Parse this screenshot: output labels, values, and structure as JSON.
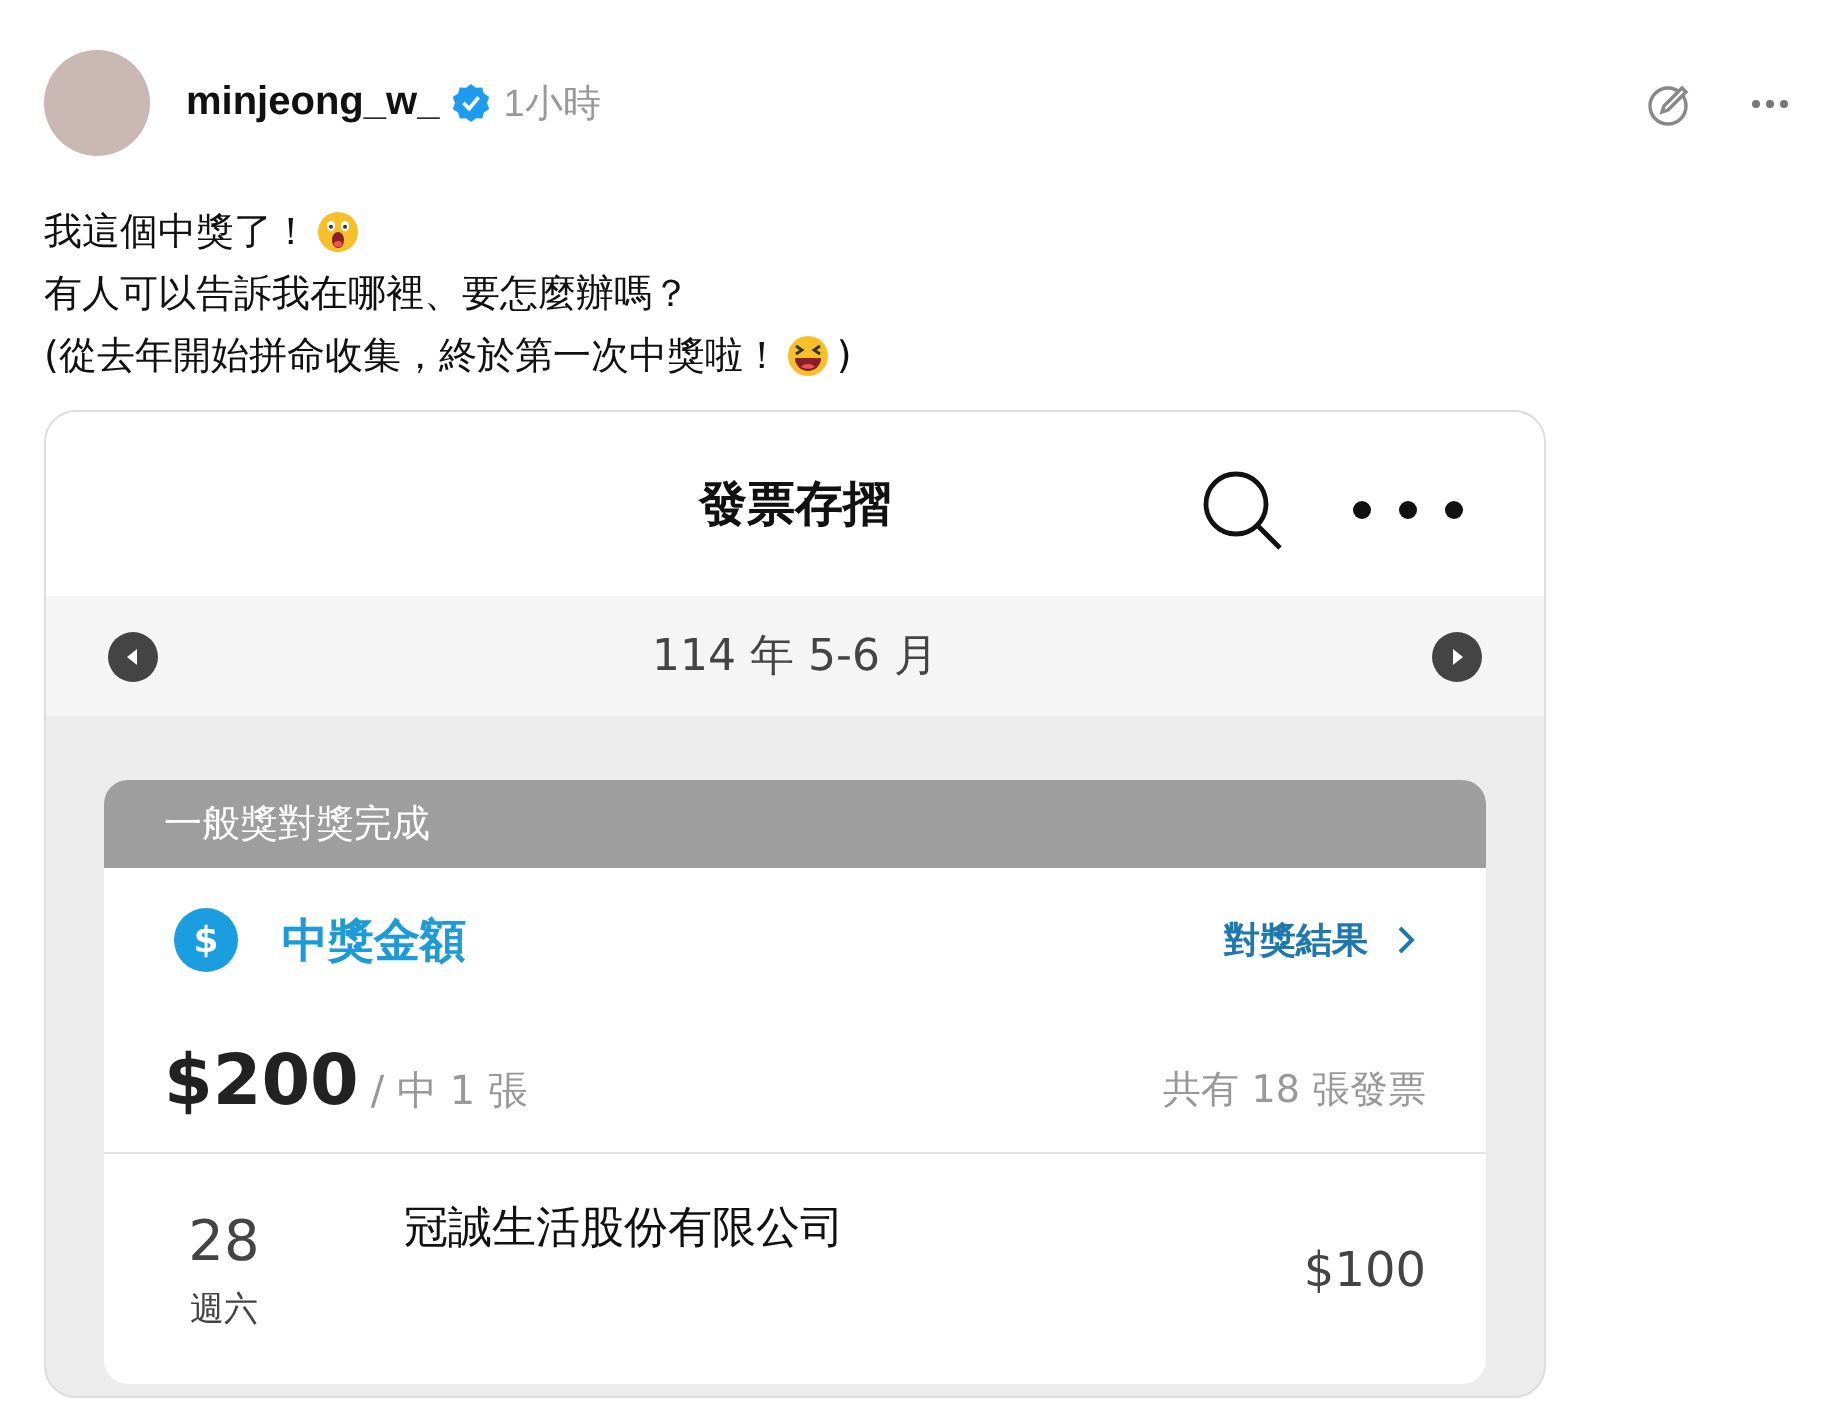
{
  "post": {
    "author": "minjeong_w_",
    "verified": true,
    "time": "1小時",
    "lines": [
      {
        "text": "我這個中獎了！",
        "kind": "shocked"
      },
      {
        "text": "有人可以告訴我在哪裡、要怎麼辦嗎？",
        "kind": "plain"
      },
      {
        "text": "(從去年開始拼命收集，終於第一次中獎啦！",
        "kind": "laughing",
        "after": ")"
      }
    ]
  },
  "screenshot": {
    "title": "發票存摺",
    "period": "114 年 5-6 月",
    "status": "一般獎對獎完成",
    "prize_icon": "$",
    "prize_label": "中獎金額",
    "result_link": "對獎結果",
    "amount": "$200",
    "winning_count": "/ 中 1 張",
    "total": "共有 18 張發票",
    "invoices": [
      {
        "day": "28",
        "weekday": "週六",
        "store": "冠誠生活股份有限公司",
        "amount": "$100"
      }
    ]
  }
}
